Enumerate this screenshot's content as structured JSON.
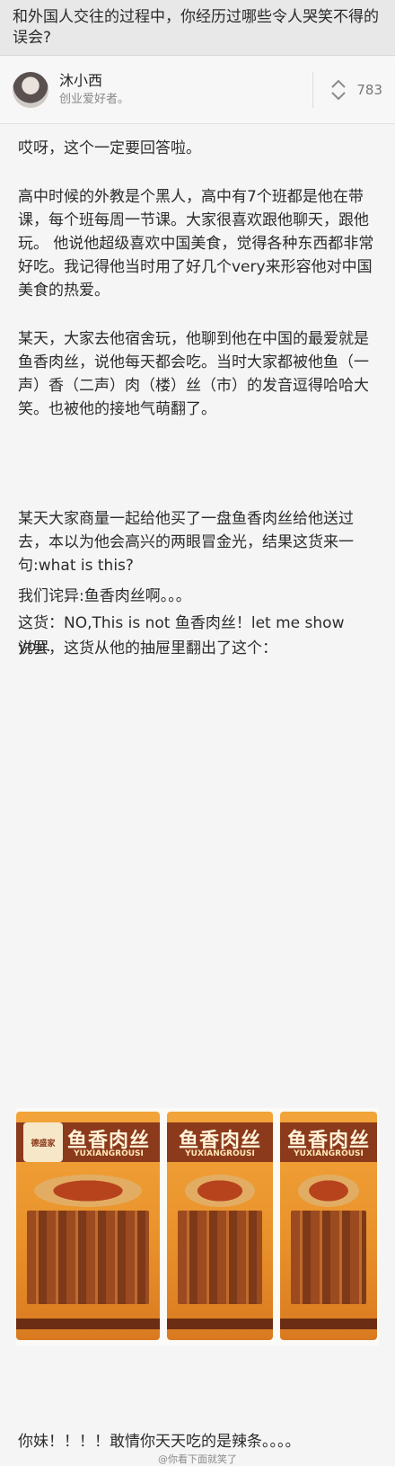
{
  "question": {
    "title": "和外国人交往的过程中，你经历过哪些令人哭笑不得的误会?"
  },
  "author": {
    "name": "沐小西",
    "bio": "创业爱好者。"
  },
  "vote": {
    "count": "783",
    "icon": "up-down-arrow-icon"
  },
  "answer": {
    "intro": "哎呀，这个一定要回答啦。",
    "para_teacher": "高中时候的外教是个黑人，高中有7个班都是他在带课，每个班每周一节课。大家很喜欢跟他聊天，跟他玩。 他说他超级喜欢中国美食，觉得各种东西都非常好吃。我记得他当时用了好几个very来形容他对中国美食的热爱。",
    "para_dorm": "某天，大家去他宿舍玩，他聊到他在中国的最爱就是鱼香肉丝，说他每天都会吃。当时大家都被他鱼（一声）香（二声）肉（楼）丝（市）的发音逗得哈哈大笑。也被他的接地气萌翻了。",
    "para_gift": "某天大家商量一起给他买了一盘鱼香肉丝给他送过去，本以为他会高兴的两眼冒金光，结果这货来一句:what is this?",
    "line_surprise": "我们诧异:鱼香肉丝啊。。。",
    "line_reply": "这货：NO,This is not 鱼香肉丝！let me show you.",
    "line_drawer": "说罢，这货从他的抽屉里翻出了这个：",
    "final": "你妹！！！！敢情你天天吃的是辣条。。。。"
  },
  "photo": {
    "product_name": "鱼香肉丝",
    "product_pinyin": "YUXIANGROUSI",
    "brand": "德盛家"
  },
  "watermark": "@你看下面就笑了"
}
